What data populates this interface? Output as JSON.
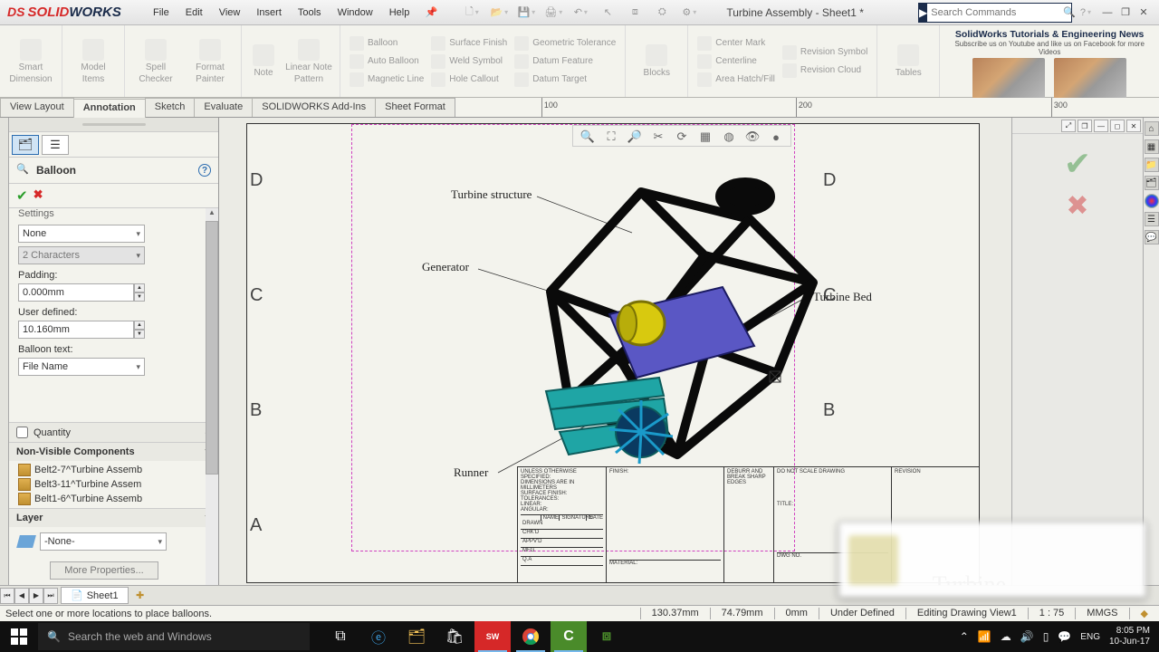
{
  "app": {
    "logo_ds": "DS",
    "logo_solid": "SOLID",
    "logo_works": "WORKS"
  },
  "menu": [
    "File",
    "Edit",
    "View",
    "Insert",
    "Tools",
    "Window",
    "Help"
  ],
  "doc_title": "Turbine Assembly - Sheet1 *",
  "search": {
    "placeholder": "Search Commands"
  },
  "ribbon": {
    "big": [
      {
        "l1": "Smart",
        "l2": "Dimension"
      },
      {
        "l1": "Model",
        "l2": "Items"
      },
      {
        "l1": "Spell",
        "l2": "Checker"
      },
      {
        "l1": "Format",
        "l2": "Painter"
      },
      {
        "l1": "Note",
        "l2": ""
      },
      {
        "l1": "Linear Note",
        "l2": "Pattern"
      }
    ],
    "ann_col1": [
      "Balloon",
      "Auto Balloon",
      "Magnetic Line"
    ],
    "ann_col2": [
      "Surface Finish",
      "Weld Symbol",
      "Hole Callout"
    ],
    "ann_col3": [
      "Geometric Tolerance",
      "Datum Feature",
      "Datum Target"
    ],
    "blocks": "Blocks",
    "center_col": [
      "Center Mark",
      "Centerline",
      "Area Hatch/Fill"
    ],
    "rev_col": [
      "Revision Symbol",
      "Revision Cloud"
    ],
    "tables": "Tables"
  },
  "promo": {
    "title": "SolidWorks Tutorials & Engineering News",
    "sub": "Subscribe us on Youtube and like us on Facebook for more Videos"
  },
  "cmd_tabs": [
    "View Layout",
    "Annotation",
    "Sketch",
    "Evaluate",
    "SOLIDWORKS Add-Ins",
    "Sheet Format"
  ],
  "active_cmd_tab": 1,
  "ruler_ticks": [
    {
      "v": "100",
      "p": 180
    },
    {
      "v": "200",
      "p": 460
    },
    {
      "v": "300",
      "p": 740
    }
  ],
  "panel": {
    "title": "Balloon",
    "settings_label": "Settings",
    "style_select": "None",
    "chars_select": "2 Characters",
    "padding_label": "Padding:",
    "padding_value": "0.000mm",
    "userdef_label": "User defined:",
    "userdef_value": "10.160mm",
    "btext_label": "Balloon text:",
    "btext_select": "File Name",
    "quantity": "Quantity",
    "nonvis": "Non-Visible Components",
    "nonvis_items": [
      "Belt2-7^Turbine Assemb",
      "Belt3-11^Turbine Assem",
      "Belt1-6^Turbine Assemb"
    ],
    "layer": "Layer",
    "layer_value": "-None-",
    "more": "More Properties..."
  },
  "drawing": {
    "rows": [
      "D",
      "C",
      "B",
      "A"
    ],
    "labels": {
      "structure": "Turbine structure",
      "generator": "Generator",
      "runner": "Runner",
      "bed": "Turbine Bed"
    },
    "titleblock": {
      "c1": [
        "UNLESS OTHERWISE SPECIFIED:",
        "DIMENSIONS ARE IN MILLIMETERS",
        "SURFACE FINISH:",
        "TOLERANCES:",
        "   LINEAR:",
        "   ANGULAR:"
      ],
      "finish": "FINISH:",
      "debur": "DEBURR AND BREAK SHARP EDGES",
      "noscale": "DO NOT SCALE DRAWING",
      "revision": "REVISION",
      "sig_headers": [
        "NAME",
        "SIGNATURE",
        "DATE"
      ],
      "sig_rows": [
        "DRAWN",
        "CHK'D",
        "APPV'D",
        "MFG",
        "Q.A"
      ],
      "material": "MATERIAL:",
      "dwgno": "DWG NO.",
      "title_t": "TITLE:"
    },
    "big_title": "Turbine"
  },
  "sheet": {
    "name": "Sheet1"
  },
  "status": {
    "msg": "Select one or more locations to place balloons.",
    "coord_x": "130.37mm",
    "coord_y": "74.79mm",
    "z": "0mm",
    "defined": "Under Defined",
    "editing": "Editing Drawing View1",
    "scale": "1 : 75",
    "units": "MMGS"
  },
  "taskbar": {
    "search": "Search the web and Windows",
    "lang": "ENG",
    "time": "8:05 PM",
    "date": "10-Jun-17"
  }
}
